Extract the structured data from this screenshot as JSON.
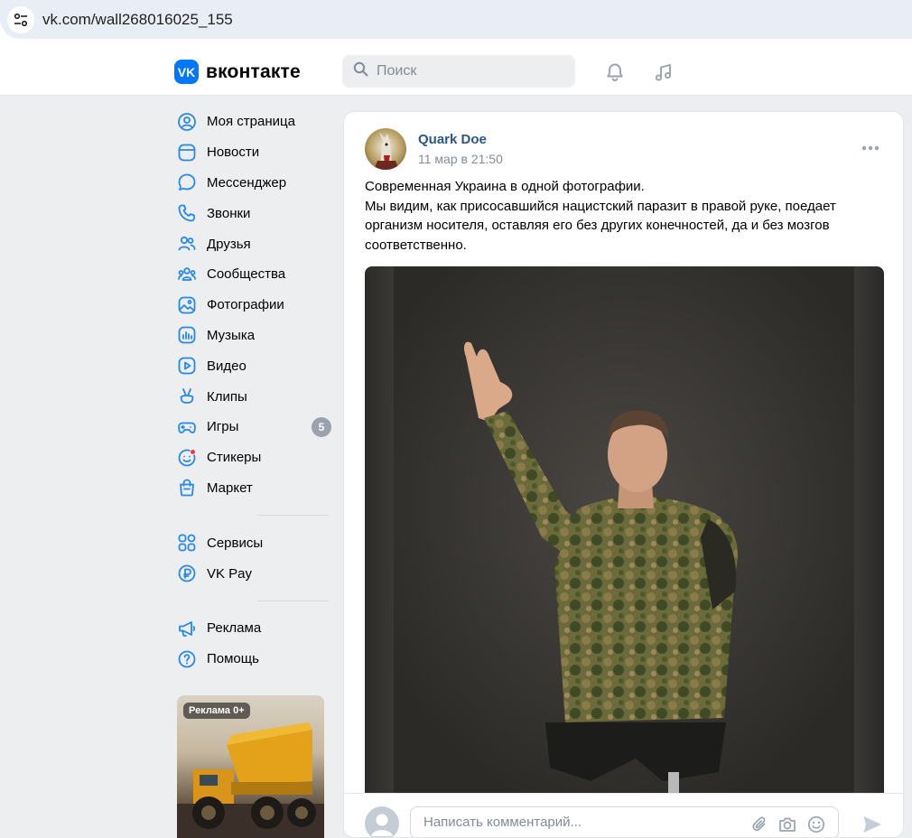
{
  "browser": {
    "url": "vk.com/wall268016025_155"
  },
  "header": {
    "logo_mark": "VK",
    "logo_text": "вконтакте",
    "search_placeholder": "Поиск"
  },
  "nav": {
    "main": [
      {
        "label": "Моя страница",
        "icon": "user-circle-icon"
      },
      {
        "label": "Новости",
        "icon": "news-icon"
      },
      {
        "label": "Мессенджер",
        "icon": "message-icon"
      },
      {
        "label": "Звонки",
        "icon": "phone-icon"
      },
      {
        "label": "Друзья",
        "icon": "friends-icon"
      },
      {
        "label": "Сообщества",
        "icon": "communities-icon"
      },
      {
        "label": "Фотографии",
        "icon": "photo-icon"
      },
      {
        "label": "Музыка",
        "icon": "music-icon"
      },
      {
        "label": "Видео",
        "icon": "video-icon"
      },
      {
        "label": "Клипы",
        "icon": "clips-icon"
      },
      {
        "label": "Игры",
        "icon": "games-icon",
        "badge": "5"
      },
      {
        "label": "Стикеры",
        "icon": "stickers-icon"
      },
      {
        "label": "Маркет",
        "icon": "market-icon"
      }
    ],
    "services": [
      {
        "label": "Сервисы",
        "icon": "services-icon"
      },
      {
        "label": "VK Pay",
        "icon": "vkpay-icon"
      }
    ],
    "misc": [
      {
        "label": "Реклама",
        "icon": "ads-icon"
      },
      {
        "label": "Помощь",
        "icon": "help-icon"
      }
    ]
  },
  "ad": {
    "badge": "Реклама 0+"
  },
  "post": {
    "author": "Quark Doe",
    "date": "11 мар в 21:50",
    "text_lines": [
      "Современная Украина в одной фотографии.",
      "Мы видим, как присосавшийся нацистский паразит в правой руке, поедает",
      "организм носителя, оставляя его без других конечностей, да и без мозгов",
      "соответственно."
    ]
  },
  "comment": {
    "placeholder": "Написать комментарий..."
  },
  "colors": {
    "brand": "#0077ff",
    "link": "#2a5885",
    "icon": "#2688eb",
    "background": "#edeef0"
  }
}
